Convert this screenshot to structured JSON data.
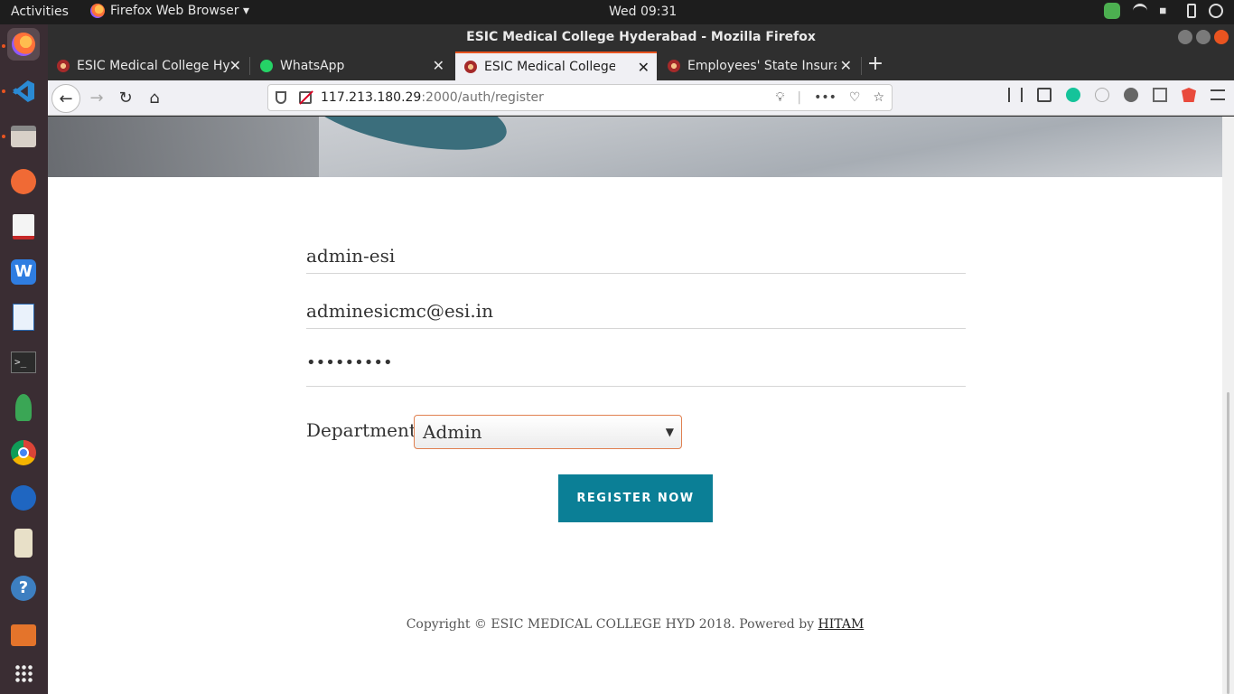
{
  "topbar": {
    "activities": "Activities",
    "app_menu": "Firefox Web Browser ▾",
    "clock": "Wed 09:31"
  },
  "window": {
    "title": "ESIC Medical College Hyderabad - Mozilla Firefox"
  },
  "tabs": [
    {
      "label": "ESIC Medical College Hyd",
      "active": false
    },
    {
      "label": "WhatsApp",
      "active": false
    },
    {
      "label": "ESIC Medical College Hyd",
      "active": true
    },
    {
      "label": "Employees' State Insuran",
      "active": false
    }
  ],
  "urlbar": {
    "host": "117.213.180.29",
    "path": ":2000/auth/register"
  },
  "form": {
    "username": "admin-esi",
    "email": "adminesicmc@esi.in",
    "password": "•••••••••",
    "department_label": "Department",
    "department_value": "Admin",
    "submit": "REGISTER NOW"
  },
  "footer": {
    "text": "Copyright © ESIC MEDICAL COLLEGE HYD 2018. Powered by",
    "link": "HITAM"
  },
  "colors": {
    "accent": "#e95420",
    "button": "#0b7f96",
    "select_border": "#e08050"
  }
}
